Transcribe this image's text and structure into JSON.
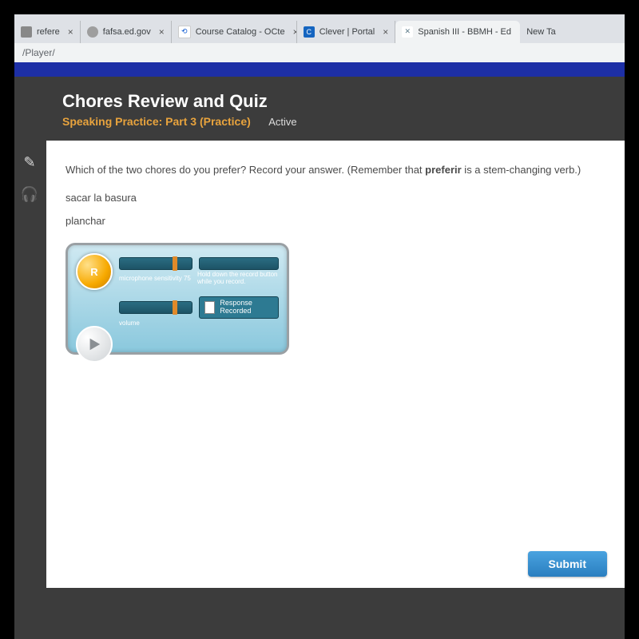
{
  "tabs": [
    {
      "label": "refere",
      "favColor": "#888"
    },
    {
      "label": "fafsa.ed.gov",
      "favColor": "#9e9e9e"
    },
    {
      "label": "Course Catalog - OCte",
      "favColor": "#0b57d0",
      "favText": "⟲"
    },
    {
      "label": "Clever | Portal",
      "favColor": "#1565c0",
      "favText": "C"
    },
    {
      "label": "Spanish III - BBMH - Ed",
      "favColor": "#607d8b",
      "favText": "✕",
      "active": true
    },
    {
      "label": "New Ta",
      "favColor": "transparent"
    }
  ],
  "address": "/Player/",
  "header": {
    "title": "Chores Review and Quiz",
    "subtitle": "Speaking Practice: Part 3 (Practice)",
    "status": "Active"
  },
  "question": {
    "prompt_pre": "Which of the two chores do you prefer? Record your answer. (Remember that ",
    "prompt_bold": "preferir",
    "prompt_post": " is a stem-changing verb.)",
    "opt1": "sacar la basura",
    "opt2": "planchar"
  },
  "recorder": {
    "rec_letter": "R",
    "mic_label": "microphone sensitivity",
    "mic_value": "75",
    "hint": "Hold down the record button while you record.",
    "vol_label": "volume",
    "response": "Response Recorded"
  },
  "submit": "Submit",
  "tools": {
    "pencil": "✎",
    "head": "🎧"
  }
}
